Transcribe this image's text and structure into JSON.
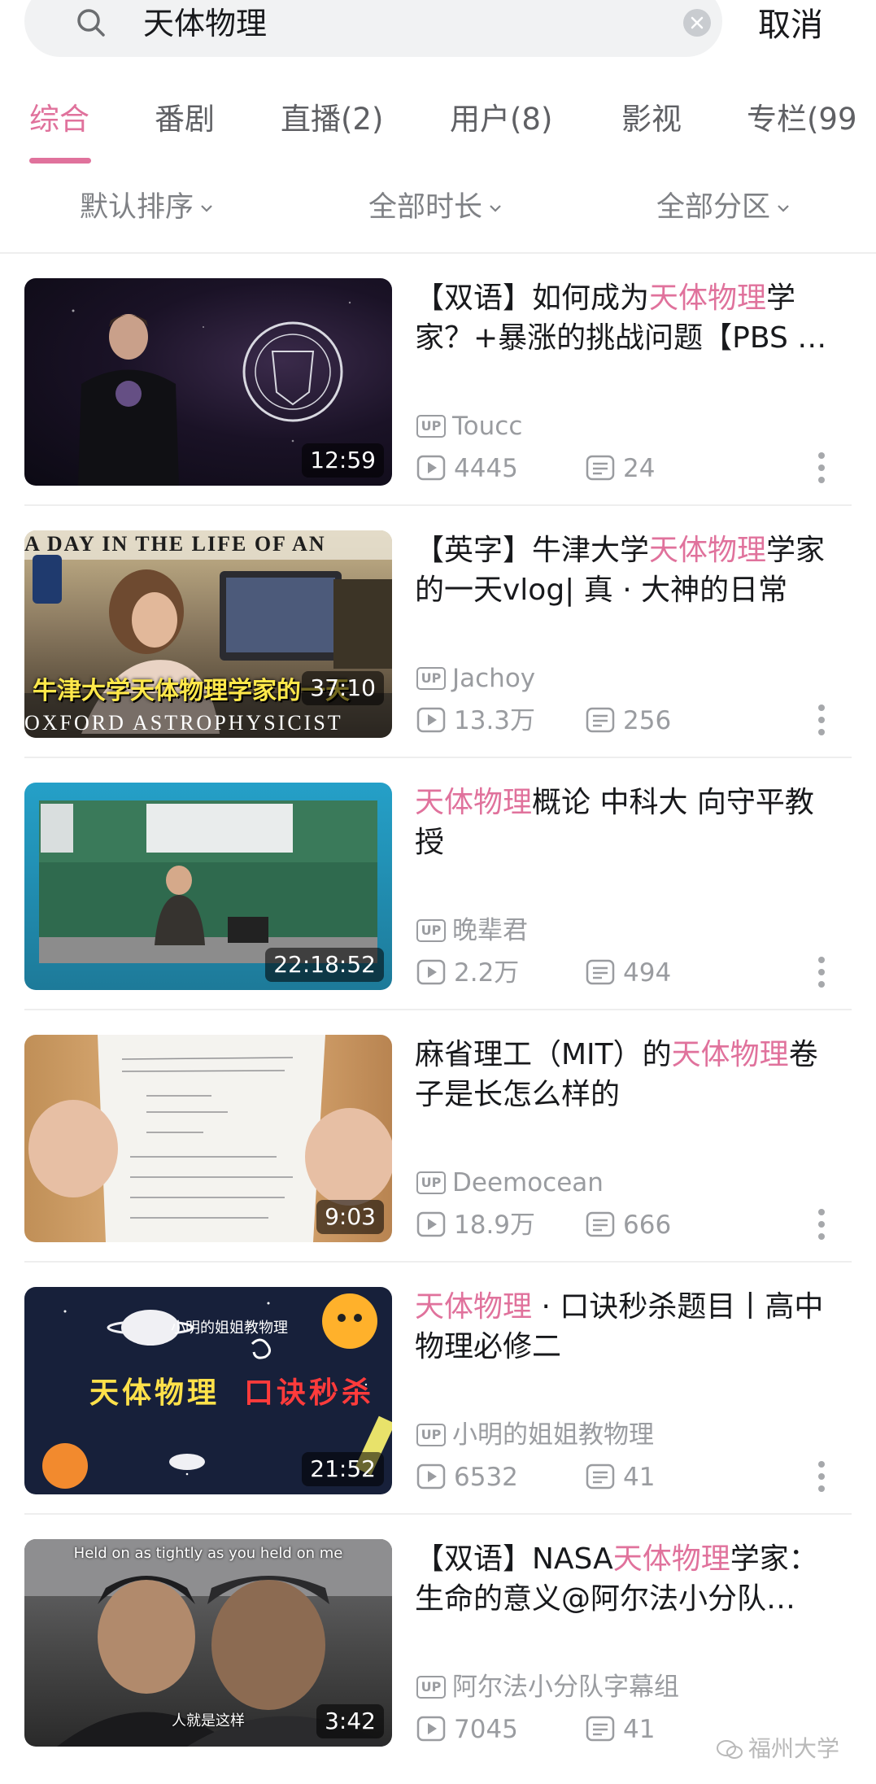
{
  "search": {
    "query": "天体物理",
    "cancel_label": "取消"
  },
  "tabs": [
    {
      "label": "综合",
      "active": true
    },
    {
      "label": "番剧"
    },
    {
      "label": "直播(2)"
    },
    {
      "label": "用户(8)"
    },
    {
      "label": "影视"
    },
    {
      "label": "专栏(99"
    }
  ],
  "filters": {
    "sort": "默认排序",
    "duration": "全部时长",
    "zone": "全部分区"
  },
  "results": [
    {
      "title_prefix": "【双语】如何成为",
      "title_highlight": "天体物理",
      "title_suffix": "学家？+暴涨的挑战问题【PBS …",
      "duration": "12:59",
      "uploader": "Toucc",
      "views": "4445",
      "comments": "24"
    },
    {
      "title_prefix": "【英字】牛津大学",
      "title_highlight": "天体物理",
      "title_suffix": "学家的一天vlog| 真 · 大神的日常",
      "duration": "37:10",
      "uploader": "Jachoy",
      "views": "13.3万",
      "comments": "256",
      "thumb_banner_top": "A DAY IN THE LIFE OF AN",
      "thumb_banner_bottom": "OXFORD ASTROPHYSICIST",
      "thumb_caption": "牛津大学天体物理学家的一天"
    },
    {
      "title_prefix": "",
      "title_highlight": "天体物理",
      "title_suffix": "概论 中科大 向守平教授",
      "duration": "22:18:52",
      "uploader": "晚辈君",
      "views": "2.2万",
      "comments": "494"
    },
    {
      "title_prefix": "麻省理工（MIT）的",
      "title_highlight": "天体物理",
      "title_suffix": "卷子是长怎么样的",
      "duration": "9:03",
      "uploader": "Deemocean",
      "views": "18.9万",
      "comments": "666"
    },
    {
      "title_prefix": "",
      "title_highlight": "天体物理",
      "title_suffix": " · 口诀秒杀题目丨高中物理必修二",
      "duration": "21:52",
      "uploader": "小明的姐姐教物理",
      "views": "6532",
      "comments": "41",
      "thumb_top_text": "小明的姐姐教物理",
      "thumb_title_a": "天体物理",
      "thumb_title_b": "口诀秒杀"
    },
    {
      "title_prefix": "【双语】NASA",
      "title_highlight": "天体物理",
      "title_suffix": "学家：生命的意义@阿尔法小分队…",
      "duration": "3:42",
      "uploader": "阿尔法小分队字幕组",
      "views": "7045",
      "comments": "41",
      "thumb_subtitle_top": "Held on as tightly as you held on me",
      "thumb_subtitle_bottom": "人就是这样"
    }
  ],
  "watermark": "福州大学",
  "colors": {
    "accent": "#e0729c",
    "text": "#18191c",
    "meta": "#9a9ca0"
  }
}
